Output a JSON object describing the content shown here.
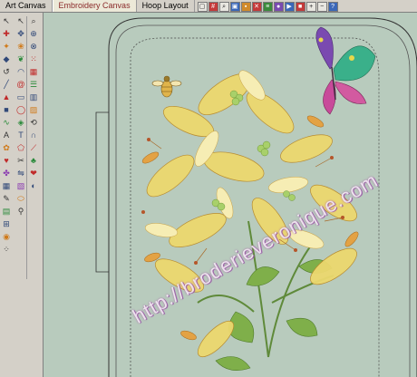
{
  "tabs": [
    {
      "label": "Art Canvas"
    },
    {
      "label": "Embroidery Canvas"
    },
    {
      "label": "Hoop Layout"
    }
  ],
  "active_tab": "Embroidery Canvas",
  "watermark": "http://broderieveronique.com",
  "toolbar_icons": [
    "hoop-icon",
    "grid-icon",
    "zoom-icon",
    "frame-icon",
    "fill-icon",
    "stitch-icon",
    "sequence-icon",
    "color-icon",
    "play-icon",
    "stop-icon",
    "zoom-in-icon",
    "zoom-out-icon",
    "help-icon"
  ],
  "colors": {
    "canvas": "#b8cbbd",
    "panel": "#d4d0c8",
    "active_tab_text": "#8a2a2a"
  }
}
